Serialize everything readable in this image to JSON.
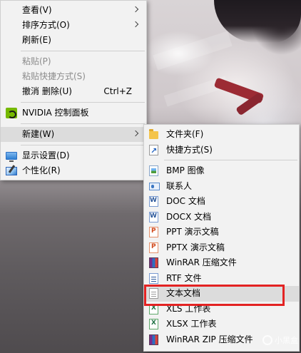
{
  "context_menu": {
    "items": [
      {
        "label": "查看(V)",
        "has_submenu": true
      },
      {
        "label": "排序方式(O)",
        "has_submenu": true
      },
      {
        "label": "刷新(E)"
      },
      {
        "label": "粘贴(P)",
        "disabled": true
      },
      {
        "label": "粘贴快捷方式(S)",
        "disabled": true
      },
      {
        "label": "撤消 删除(U)",
        "shortcut": "Ctrl+Z"
      },
      {
        "label": "NVIDIA 控制面板",
        "icon": "nvidia-icon"
      },
      {
        "label": "新建(W)",
        "has_submenu": true,
        "active": true
      },
      {
        "label": "显示设置(D)",
        "icon": "display-settings-icon"
      },
      {
        "label": "个性化(R)",
        "icon": "personalize-icon"
      }
    ]
  },
  "new_submenu": {
    "items": [
      {
        "label": "文件夹(F)",
        "icon": "folder-icon"
      },
      {
        "label": "快捷方式(S)",
        "icon": "shortcut-icon"
      },
      {
        "label": "BMP 图像",
        "icon": "bmp-image-icon"
      },
      {
        "label": "联系人",
        "icon": "contact-icon"
      },
      {
        "label": "DOC 文档",
        "icon": "doc-file-icon"
      },
      {
        "label": "DOCX 文档",
        "icon": "docx-file-icon"
      },
      {
        "label": "PPT 演示文稿",
        "icon": "ppt-file-icon"
      },
      {
        "label": "PPTX 演示文稿",
        "icon": "pptx-file-icon"
      },
      {
        "label": "WinRAR 压缩文件",
        "icon": "winrar-icon"
      },
      {
        "label": "RTF 文件",
        "icon": "rtf-file-icon"
      },
      {
        "label": "文本文档",
        "icon": "text-file-icon",
        "highlighted": true
      },
      {
        "label": "XLS 工作表",
        "icon": "xls-file-icon"
      },
      {
        "label": "XLSX 工作表",
        "icon": "xlsx-file-icon"
      },
      {
        "label": "WinRAR ZIP 压缩文件",
        "icon": "winrar-zip-icon"
      }
    ]
  },
  "annotation": {
    "color": "#e32323"
  },
  "watermark": {
    "text": "小黑盒"
  }
}
